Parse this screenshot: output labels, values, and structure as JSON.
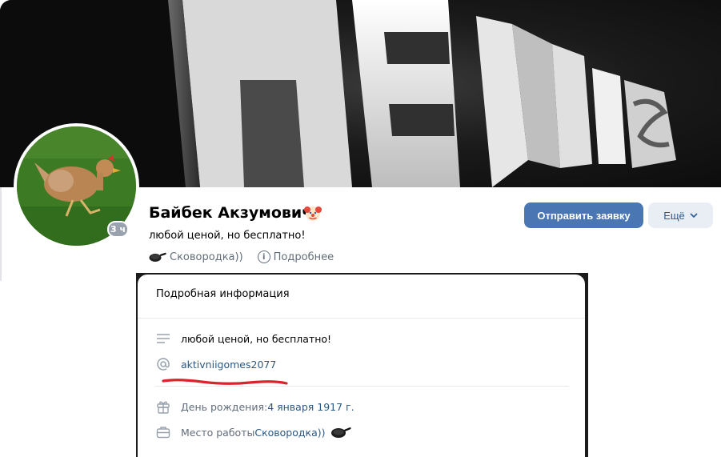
{
  "profile": {
    "name": "Байбек Акзумович",
    "name_emoji": "clown-face-icon",
    "status": "любой ценой, но бесплатно!",
    "online_badge": "3 ч",
    "quick_work": "Сковородка))",
    "more_details": "Подробнее"
  },
  "actions": {
    "send_request": "Отправить заявку",
    "more": "Ещё"
  },
  "cover": {
    "text": "PENIS"
  },
  "details_modal": {
    "title": "Подробная информация",
    "about": "любой ценой, но бесплатно!",
    "nickname": "aktivniigomes2077",
    "birthday_label": "День рождения: ",
    "birthday_value": "4 января 1917 г.",
    "work_label": "Место работы ",
    "work_value": "Сковородка))"
  },
  "colors": {
    "primary_button": "#4a77b4",
    "link": "#2a5885",
    "annotation_underline": "#d8242a"
  }
}
